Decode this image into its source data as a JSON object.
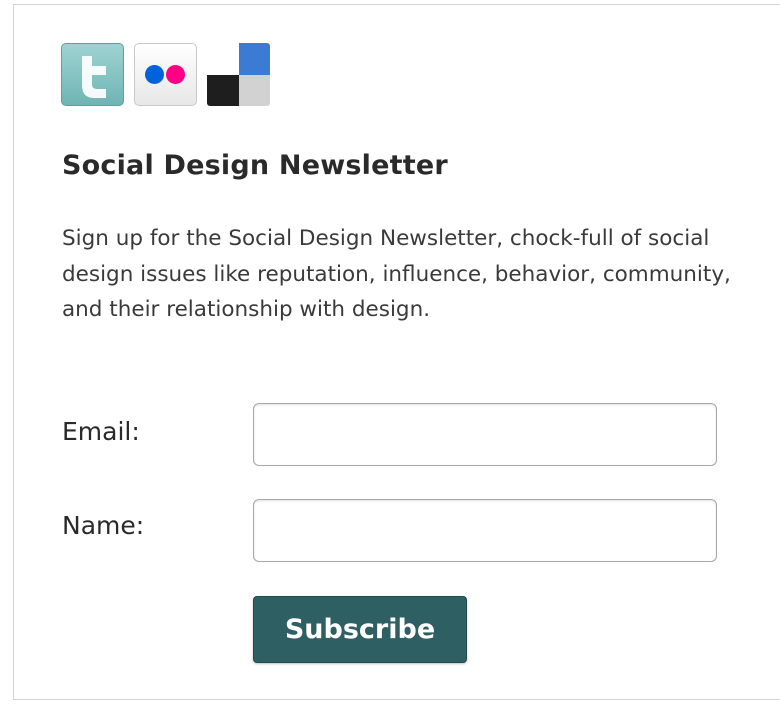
{
  "social_icons": [
    {
      "name": "twitter-icon",
      "color": "#8cc8c7"
    },
    {
      "name": "flickr-icon",
      "colors": [
        "#0063dc",
        "#ff0084"
      ]
    },
    {
      "name": "delicious-icon",
      "colors": [
        "#3b7bd4",
        "#1e1e1e",
        "#d2d2d2"
      ]
    }
  ],
  "newsletter": {
    "title": "Social Design Newsletter",
    "description": "Sign up for the Social Design Newsletter, chock-full of social design issues like reputation, influence, behavior, community, and their relationship with design.",
    "email_label": "Email:",
    "email_value": "",
    "name_label": "Name:",
    "name_value": "",
    "subscribe_label": "Subscribe"
  },
  "colors": {
    "button": "#2e5f63",
    "title_text": "#2a2a2a"
  }
}
